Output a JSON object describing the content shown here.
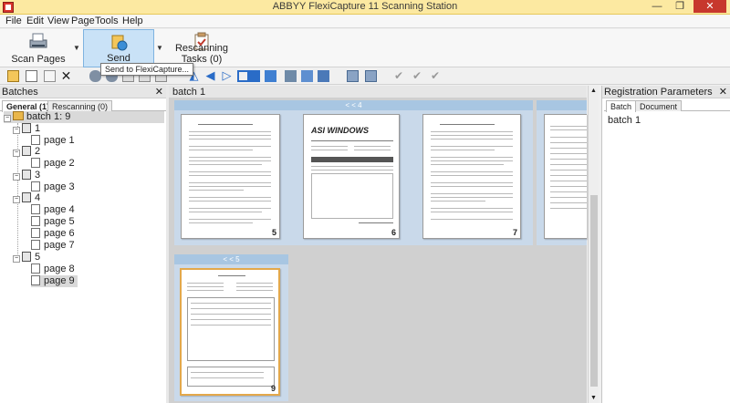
{
  "window": {
    "title": "ABBYY FlexiCapture 11 Scanning Station",
    "close_label": "✕",
    "restore_label": "❐",
    "minimize_label": "—"
  },
  "menu": [
    "File",
    "Edit",
    "View",
    "Page",
    "Tools",
    "Help"
  ],
  "ribbon": {
    "scan_label": "Scan Pages",
    "send_label": "Send",
    "rescan_label": "Rescanning Tasks (0)",
    "tooltip": "Send to FlexiCapture..."
  },
  "batches_panel": {
    "title": "Batches",
    "close": "✕",
    "tabs": [
      "General (1)",
      "Rescanning (0)"
    ],
    "batch_label": "batch 1: 9",
    "groups": [
      {
        "label": "1",
        "pages": [
          "page 1"
        ]
      },
      {
        "label": "2",
        "pages": [
          "page 2"
        ]
      },
      {
        "label": "3",
        "pages": [
          "page 3"
        ]
      },
      {
        "label": "4",
        "pages": [
          "page 4",
          "page 5",
          "page 6",
          "page 7"
        ]
      },
      {
        "label": "5",
        "pages": [
          "page 8",
          "page 9"
        ]
      }
    ]
  },
  "center": {
    "title": "batch 1",
    "group4_bar": "< < 4",
    "group5_bar": "< < 5",
    "thumbs": [
      "5",
      "6",
      "7",
      "9"
    ],
    "logo_text": "ASI WINDOWS"
  },
  "registration": {
    "title": "Registration Parameters",
    "close": "✕",
    "tabs": [
      "Batch",
      "Document"
    ],
    "value": "batch 1"
  },
  "colors": {
    "titlebar": "#fce9a1",
    "send_highlight": "#c9e2f7",
    "selected_border": "#e3a84b",
    "group_bar": "#a8c6e2"
  }
}
